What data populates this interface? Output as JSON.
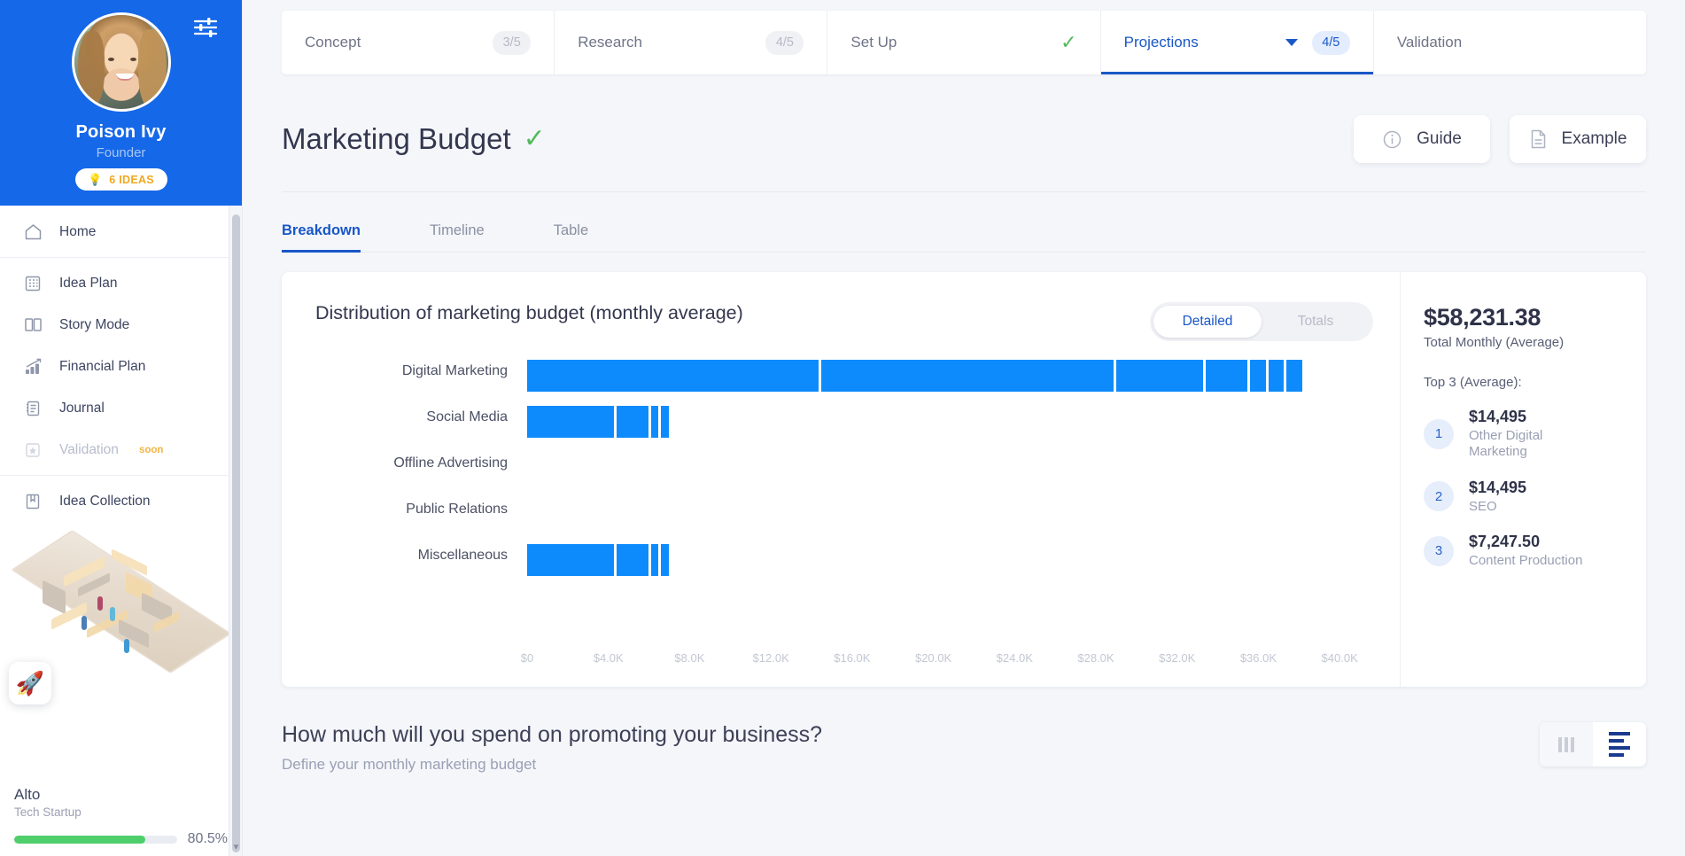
{
  "sidebar": {
    "settings_icon": "sliders-icon",
    "profile": {
      "name": "Poison Ivy",
      "role": "Founder",
      "badge_icon": "lightbulb-icon",
      "badge_label": "6 IDEAS"
    },
    "nav": [
      {
        "icon": "home-icon",
        "label": "Home",
        "dim": false,
        "tag": ""
      },
      {
        "icon": "grid-icon",
        "label": "Idea Plan",
        "dim": false,
        "tag": ""
      },
      {
        "icon": "book-icon",
        "label": "Story Mode",
        "dim": false,
        "tag": ""
      },
      {
        "icon": "chart-up-icon",
        "label": "Financial Plan",
        "dim": false,
        "tag": ""
      },
      {
        "icon": "notebook-icon",
        "label": "Journal",
        "dim": true,
        "tag": ""
      },
      {
        "icon": "star-box-icon",
        "label": "Validation",
        "dim": true,
        "tag": "soon"
      },
      {
        "icon": "bookmark-icon",
        "label": "Idea Collection",
        "dim": false,
        "tag": ""
      }
    ],
    "venture": {
      "logo_icon": "rocket-icon",
      "name": "Alto",
      "type": "Tech Startup",
      "progress_pct": 80.5,
      "progress_label": "80.5%",
      "progress_color": "#4fce6c"
    }
  },
  "steps": [
    {
      "name": "Concept",
      "count": "3/5",
      "state": "idle",
      "icon": ""
    },
    {
      "name": "Research",
      "count": "4/5",
      "state": "idle",
      "icon": ""
    },
    {
      "name": "Set Up",
      "count": "",
      "state": "done",
      "icon": "check-icon"
    },
    {
      "name": "Projections",
      "count": "4/5",
      "state": "active",
      "icon": "chevron-down-icon"
    },
    {
      "name": "Validation",
      "count": "",
      "state": "idle",
      "icon": ""
    }
  ],
  "header": {
    "title": "Marketing Budget",
    "title_status_icon": "check-icon",
    "guide_label": "Guide",
    "guide_icon": "info-icon",
    "example_label": "Example",
    "example_icon": "document-icon"
  },
  "sub_tabs": [
    {
      "label": "Breakdown",
      "active": true
    },
    {
      "label": "Timeline",
      "active": false
    },
    {
      "label": "Table",
      "active": false
    }
  ],
  "chart_panel": {
    "toggle": [
      {
        "label": "Detailed",
        "active": true
      },
      {
        "label": "Totals",
        "active": false
      }
    ]
  },
  "summary": {
    "total_amount": "$58,231.38",
    "total_label": "Total Monthly (Average)",
    "top_label": "Top 3 (Average):",
    "items": [
      {
        "rank": "1",
        "value": "$14,495",
        "name": "Other Digital Marketing"
      },
      {
        "rank": "2",
        "value": "$14,495",
        "name": "SEO"
      },
      {
        "rank": "3",
        "value": "$7,247.50",
        "name": "Content Production"
      }
    ]
  },
  "question": {
    "title": "How much will you spend on promoting your business?",
    "subtitle": "Define your monthly marketing budget",
    "views": [
      {
        "icon": "columns-view-icon",
        "selected": false
      },
      {
        "icon": "rows-view-icon",
        "selected": true
      }
    ]
  },
  "chart_data": {
    "type": "bar",
    "title": "Distribution of marketing budget (monthly average)",
    "orientation": "horizontal",
    "stacked": true,
    "xlabel": "",
    "ylabel": "",
    "xlim": [
      0,
      42000
    ],
    "grid": false,
    "accent_color": "#0d8bfd",
    "tick_labels": [
      "$0",
      "$4.0K",
      "$8.0K",
      "$12.0K",
      "$16.0K",
      "$20.0K",
      "$24.0K",
      "$28.0K",
      "$32.0K",
      "$36.0K",
      "$40.0K"
    ],
    "tick_values": [
      0,
      4000,
      8000,
      12000,
      16000,
      20000,
      24000,
      28000,
      32000,
      36000,
      40000
    ],
    "categories": [
      "Digital Marketing",
      "Social Media",
      "Offline Advertising",
      "Public Relations",
      "Miscellaneous"
    ],
    "rows": [
      {
        "category": "Digital Marketing",
        "total": 37000,
        "segments": [
          14495,
          14495,
          4400,
          2200,
          900,
          900,
          900
        ]
      },
      {
        "category": "Social Media",
        "total": 7247,
        "segments": [
          4400,
          1700,
          500,
          500
        ]
      },
      {
        "category": "Offline Advertising",
        "total": 0,
        "segments": []
      },
      {
        "category": "Public Relations",
        "total": 0,
        "segments": []
      },
      {
        "category": "Miscellaneous",
        "total": 7247,
        "segments": [
          4400,
          1700,
          500,
          500
        ]
      }
    ]
  }
}
